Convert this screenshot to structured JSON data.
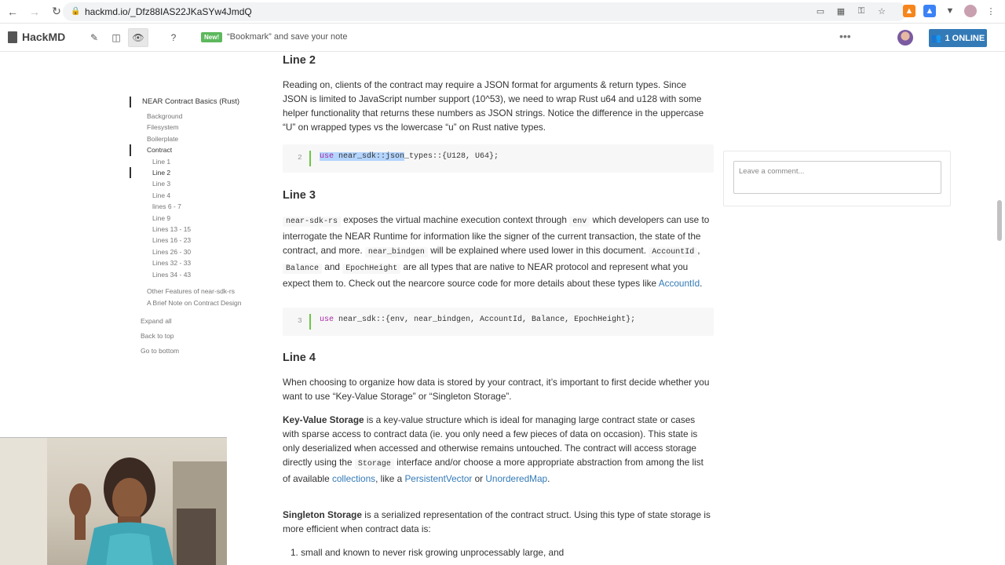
{
  "browser": {
    "url": "hackmd.io/_Dfz88IAS22JKaSYw4JmdQ"
  },
  "navbar": {
    "brand": "HackMD",
    "new_badge": "New!",
    "bookmark_text": "“Bookmark” and save your note",
    "online_label": "1 ONLINE"
  },
  "toc": {
    "title": "NEAR Contract Basics (Rust)",
    "items": [
      {
        "label": "Background",
        "level": 1
      },
      {
        "label": "Filesystem",
        "level": 1
      },
      {
        "label": "Boilerplate",
        "level": 1
      },
      {
        "label": "Contract",
        "level": 1
      },
      {
        "label": "Line 1",
        "level": 2
      },
      {
        "label": "Line 2",
        "level": 2
      },
      {
        "label": "Line 3",
        "level": 2
      },
      {
        "label": "Line 4",
        "level": 2
      },
      {
        "label": "lines 6 - 7",
        "level": 2
      },
      {
        "label": "Line 9",
        "level": 2
      },
      {
        "label": "Lines 13 - 15",
        "level": 2
      },
      {
        "label": "Lines 16 - 23",
        "level": 2
      },
      {
        "label": "Lines 26 - 30",
        "level": 2
      },
      {
        "label": "Lines 32 - 33",
        "level": 2
      },
      {
        "label": "Lines 34 - 43",
        "level": 2
      }
    ],
    "other": [
      "Other Features of near-sdk-rs",
      "A Brief Note on Contract Design"
    ],
    "expand_all": "Expand all",
    "back_to_top": "Back to top",
    "go_to_bottom": "Go to bottom"
  },
  "doc": {
    "line2": {
      "heading": "Line 2",
      "para": "Reading on, clients of the contract may require a JSON format for arguments & return types. Since JSON is limited to JavaScript number support (10^53), we need to wrap Rust u64 and u128 with some helper functionality that returns these numbers as JSON strings. Notice the difference in the uppercase “U” on wrapped types vs the lowercase “u” on Rust native types.",
      "code_ln": "2",
      "code_kw": "use",
      "code_sel": " near_sdk::json",
      "code_rest": "_types::{U128, U64};"
    },
    "line3": {
      "heading": "Line 3",
      "c_sdk": "near-sdk-rs",
      "t1": " exposes the virtual machine execution context through ",
      "c_env": "env",
      "t2": " which developers can use to interrogate the NEAR Runtime for information like the signer of the current transaction, the state of the contract, and more. ",
      "c_bindgen": "near_bindgen",
      "t3": " will be explained where used lower in this document. ",
      "c_account": "AccountId",
      "t4": ", ",
      "c_balance": "Balance",
      "t5": " and ",
      "c_epoch": "EpochHeight",
      "t6": " are all types that are native to NEAR protocol and represent what you expect them to. Check out the nearcore source code for more details about these types like ",
      "link": "AccountId",
      "t7": ".",
      "code_ln": "3",
      "code_kw": "use",
      "code_rest": " near_sdk::{env, near_bindgen, AccountId, Balance, EpochHeight};"
    },
    "line4": {
      "heading": "Line 4",
      "para1": "When choosing to organize how data is stored by your contract, it’s important to first decide whether you want to use “Key-Value Storage” or “Singleton Storage”.",
      "kv_bold": "Key-Value Storage",
      "kv_t1": " is a key-value structure which is ideal for managing large contract state or cases with sparse access to contract data (ie. you only need a few pieces of data on occasion). This state is only deserialized when accessed and otherwise remains untouched. The contract will access storage directly using the ",
      "kv_code": "Storage",
      "kv_t2": " interface and/or choose a more appropriate abstraction from among the list of available ",
      "kv_link1": "collections",
      "kv_t3": ", like a ",
      "kv_link2": "PersistentVector",
      "kv_t4": " or ",
      "kv_link3": "UnorderedMap",
      "kv_t5": ".",
      "st_bold": "Singleton Storage",
      "st_t1": " is a serialized representation of the contract struct. Using this type of state storage is more efficient when contract data is:",
      "list_item_1": "1.  small and known to never risk growing unprocessably large, and"
    }
  },
  "comment": {
    "placeholder": "Leave a comment..."
  },
  "colors": {
    "accent": "#337ab7",
    "new_badge": "#5cb85c",
    "code_marker": "#6cc644"
  }
}
